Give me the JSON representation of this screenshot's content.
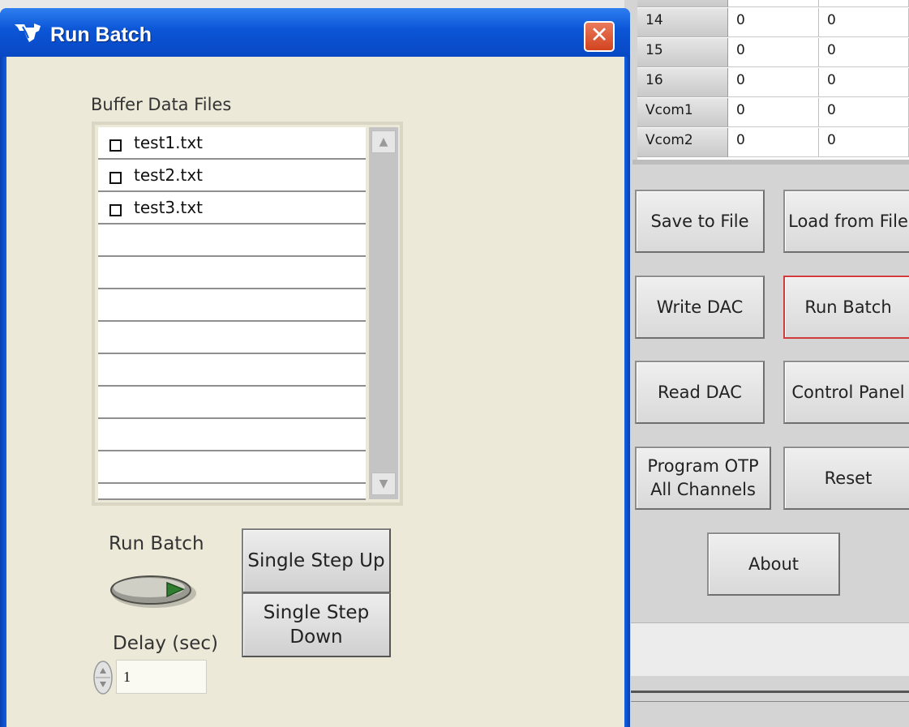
{
  "dialog": {
    "title": "Run Batch",
    "close_glyph": "✕",
    "list_label": "Buffer Data Files",
    "files": [
      "test1.txt",
      "test2.txt",
      "test3.txt"
    ],
    "scroll_up_glyph": "▲",
    "scroll_down_glyph": "▼",
    "run_batch_label": "Run Batch",
    "single_step_up": "Single Step Up",
    "single_step_down": "Single Step Down",
    "delay_label": "Delay (sec)",
    "delay_value": "1"
  },
  "table": {
    "rows": [
      {
        "label": "14",
        "v1": "0",
        "v2": "0"
      },
      {
        "label": "15",
        "v1": "0",
        "v2": "0"
      },
      {
        "label": "16",
        "v1": "0",
        "v2": "0"
      },
      {
        "label": "Vcom1",
        "v1": "0",
        "v2": "0"
      },
      {
        "label": "Vcom2",
        "v1": "0",
        "v2": "0"
      }
    ]
  },
  "panel": {
    "save_to_file": "Save to File",
    "load_from_file": "Load from File",
    "write_dac": "Write DAC",
    "run_batch": "Run Batch",
    "read_dac": "Read DAC",
    "control_panel": "Control Panel",
    "program_otp": "Program OTP All Channels",
    "reset": "Reset",
    "about": "About"
  },
  "icons": {
    "title_logo": "texas-instruments-logo-icon",
    "toggle": "run-batch-toggle-switch"
  },
  "colors": {
    "titlebar": "#0b55d6",
    "dialog_bg": "#ece9d8",
    "close_button": "#d2431f",
    "active_button_border": "#d23b3b",
    "toggle_led": "#2f7d2f"
  }
}
